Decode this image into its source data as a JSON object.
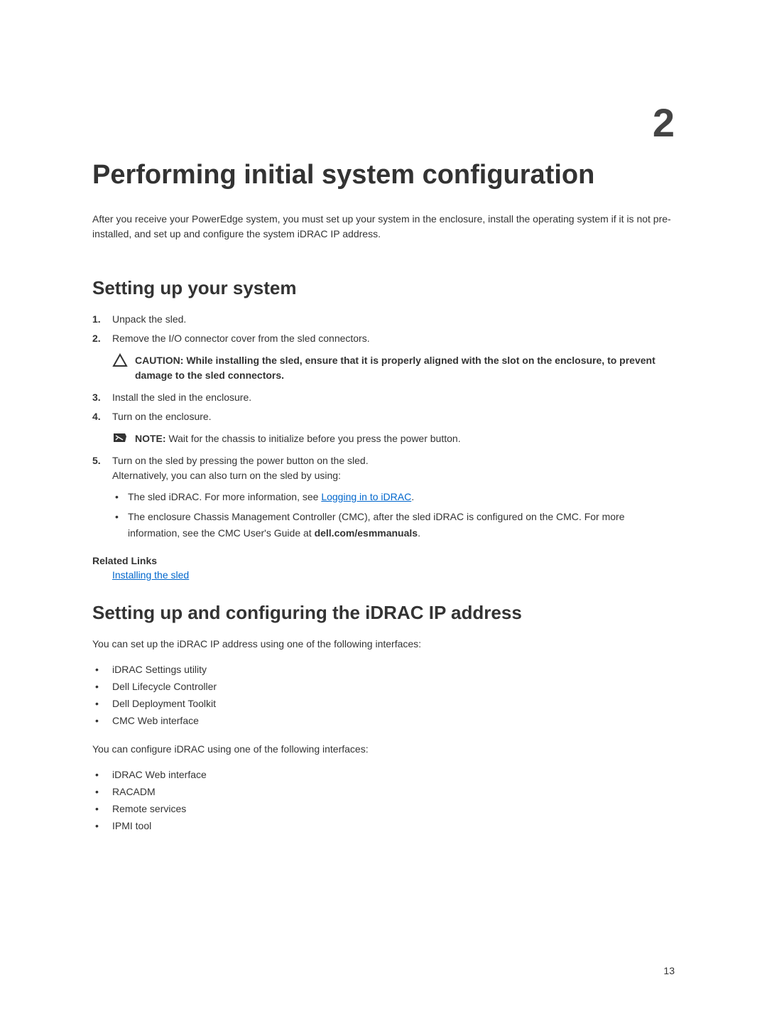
{
  "chapter_number": "2",
  "h1": "Performing initial system configuration",
  "intro": "After you receive your PowerEdge system, you must set up your system in the enclosure, install the operating system if it is not pre-installed, and set up and configure the system iDRAC IP address.",
  "section1": {
    "title": "Setting up your system",
    "steps": {
      "s1_num": "1.",
      "s1_text": "Unpack the sled.",
      "s2_num": "2.",
      "s2_text": "Remove the I/O connector cover from the sled connectors.",
      "caution_label": "CAUTION: ",
      "caution_text": "While installing the sled, ensure that it is properly aligned with the slot on the enclosure, to prevent damage to the sled connectors.",
      "s3_num": "3.",
      "s3_text": "Install the sled in the enclosure.",
      "s4_num": "4.",
      "s4_text": "Turn on the enclosure.",
      "note_label": "NOTE: ",
      "note_text": "Wait for the chassis to initialize before you press the power button.",
      "s5_num": "5.",
      "s5_text": "Turn on the sled by pressing the power button on the sled.",
      "s5_alt": "Alternatively, you can also turn on the sled by using:",
      "s5_b1_pre": "The sled iDRAC. For more information, see ",
      "s5_b1_link": "Logging in to iDRAC",
      "s5_b1_post": ".",
      "s5_b2_pre": "The enclosure Chassis Management Controller (CMC), after the sled iDRAC is configured on the CMC. For more information, see the CMC User's Guide at ",
      "s5_b2_bold": "dell.com/esmmanuals",
      "s5_b2_post": "."
    },
    "related_title": "Related Links",
    "related_link": "Installing the sled"
  },
  "section2": {
    "title": "Setting up and configuring the iDRAC IP address",
    "intro1": "You can set up the iDRAC IP address using one of the following interfaces:",
    "list1": {
      "i1": "iDRAC Settings utility",
      "i2": "Dell Lifecycle Controller",
      "i3": "Dell Deployment Toolkit",
      "i4": "CMC Web interface"
    },
    "intro2": "You can configure iDRAC using one of the following interfaces:",
    "list2": {
      "i1": "iDRAC Web interface",
      "i2": "RACADM",
      "i3": "Remote services",
      "i4": "IPMI tool"
    }
  },
  "page_number": "13"
}
